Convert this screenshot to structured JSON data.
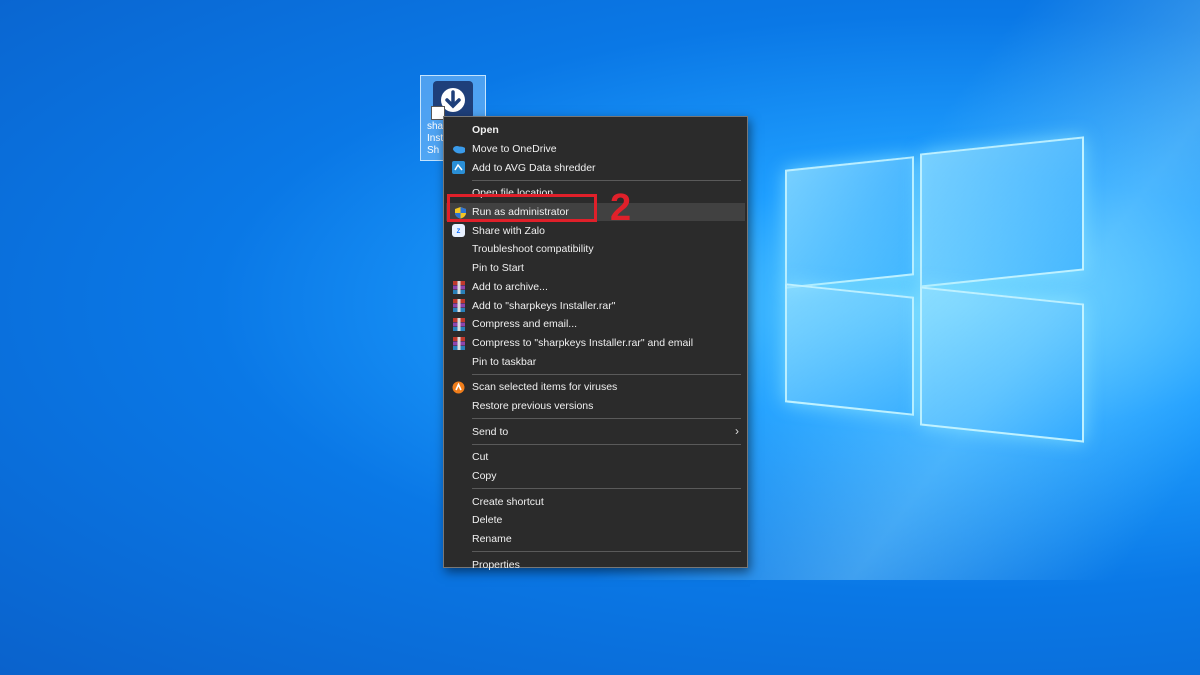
{
  "desktop": {
    "icon_label": "sha Insta Sh"
  },
  "menu": {
    "items": [
      {
        "label": "Open",
        "bold": true
      },
      {
        "label": "Move to OneDrive",
        "icon": "onedrive-icon"
      },
      {
        "label": "Add to AVG Data shredder",
        "icon": "avg-shredder-icon"
      },
      {
        "label": "Open file location"
      },
      {
        "label": "Run as administrator",
        "icon": "uac-shield-icon",
        "highlighted": true
      },
      {
        "label": "Share with Zalo",
        "icon": "zalo-icon"
      },
      {
        "label": "Troubleshoot compatibility"
      },
      {
        "label": "Pin to Start"
      },
      {
        "label": "Add to archive...",
        "icon": "winrar-icon"
      },
      {
        "label": "Add to \"sharpkeys Installer.rar\"",
        "icon": "winrar-icon"
      },
      {
        "label": "Compress and email...",
        "icon": "winrar-icon"
      },
      {
        "label": "Compress to \"sharpkeys Installer.rar\" and email",
        "icon": "winrar-icon"
      },
      {
        "label": "Pin to taskbar"
      },
      {
        "label": "Scan selected items for viruses",
        "icon": "avast-icon"
      },
      {
        "label": "Restore previous versions"
      },
      {
        "label": "Send to",
        "submenu": true
      },
      {
        "label": "Cut"
      },
      {
        "label": "Copy"
      },
      {
        "label": "Create shortcut"
      },
      {
        "label": "Delete"
      },
      {
        "label": "Rename"
      },
      {
        "label": "Properties"
      }
    ]
  },
  "annotation": {
    "step_number": "2"
  },
  "colors": {
    "menu_bg": "#2b2b2b",
    "highlight_bg": "#414141",
    "annotation_red": "#e0202a"
  }
}
